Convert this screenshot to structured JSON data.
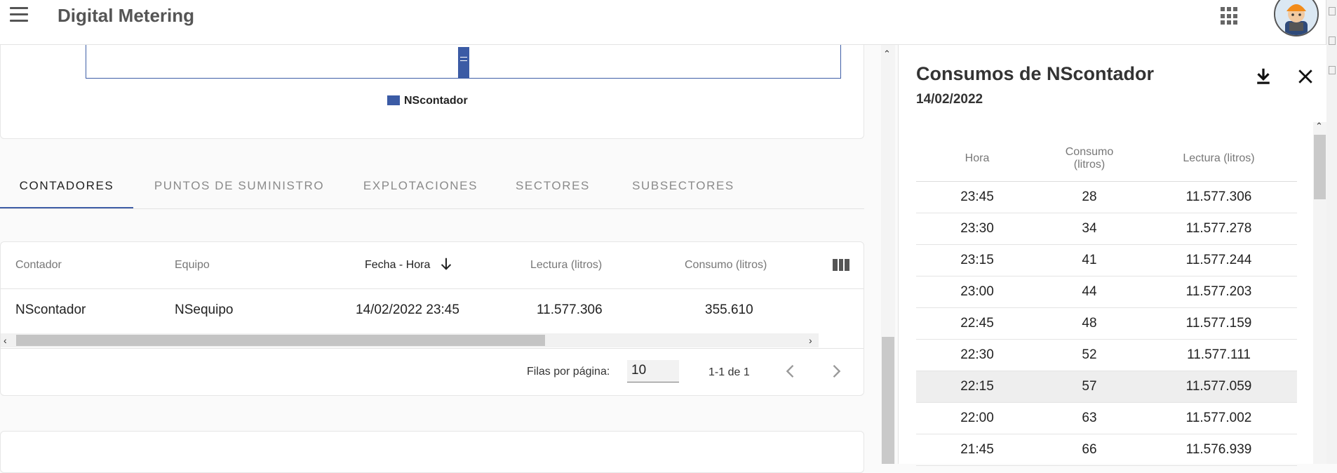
{
  "app": {
    "title": "Digital Metering"
  },
  "chart": {
    "legend": "NScontador",
    "colors": {
      "series": "#3b5ba5"
    },
    "visible_bar_level": 0.92
  },
  "tabs": [
    {
      "label": "CONTADORES",
      "active": true
    },
    {
      "label": "PUNTOS DE SUMINISTRO",
      "active": false
    },
    {
      "label": "EXPLOTACIONES",
      "active": false
    },
    {
      "label": "SECTORES",
      "active": false
    },
    {
      "label": "SUBSECTORES",
      "active": false
    }
  ],
  "table": {
    "headers": [
      "Contador",
      "Equipo",
      "Fecha - Hora",
      "Lectura (litros)",
      "Consumo (litros)"
    ],
    "sorted_column": "Fecha - Hora",
    "sort_direction": "desc",
    "rows": [
      [
        "NScontador",
        "NSequipo",
        "14/02/2022 23:45",
        "11.577.306",
        "355.610"
      ]
    ]
  },
  "pagination": {
    "rows_label": "Filas por página:",
    "rows_per_page": "10",
    "range": "1-1 de 1"
  },
  "panel": {
    "title": "Consumos de NScontador",
    "date": "14/02/2022",
    "headers": {
      "hora": "Hora",
      "consumo": "Consumo\n(litros)",
      "lectura": "Lectura (litros)"
    },
    "rows": [
      [
        "23:45",
        "28",
        "11.577.306"
      ],
      [
        "23:30",
        "34",
        "11.577.278"
      ],
      [
        "23:15",
        "41",
        "11.577.244"
      ],
      [
        "23:00",
        "44",
        "11.577.203"
      ],
      [
        "22:45",
        "48",
        "11.577.159"
      ],
      [
        "22:30",
        "52",
        "11.577.111"
      ],
      [
        "22:15",
        "57",
        "11.577.059"
      ],
      [
        "22:00",
        "63",
        "11.577.002"
      ],
      [
        "21:45",
        "66",
        "11.576.939"
      ]
    ],
    "highlighted_row": 6,
    "icons": [
      "download-icon",
      "close-icon"
    ]
  }
}
